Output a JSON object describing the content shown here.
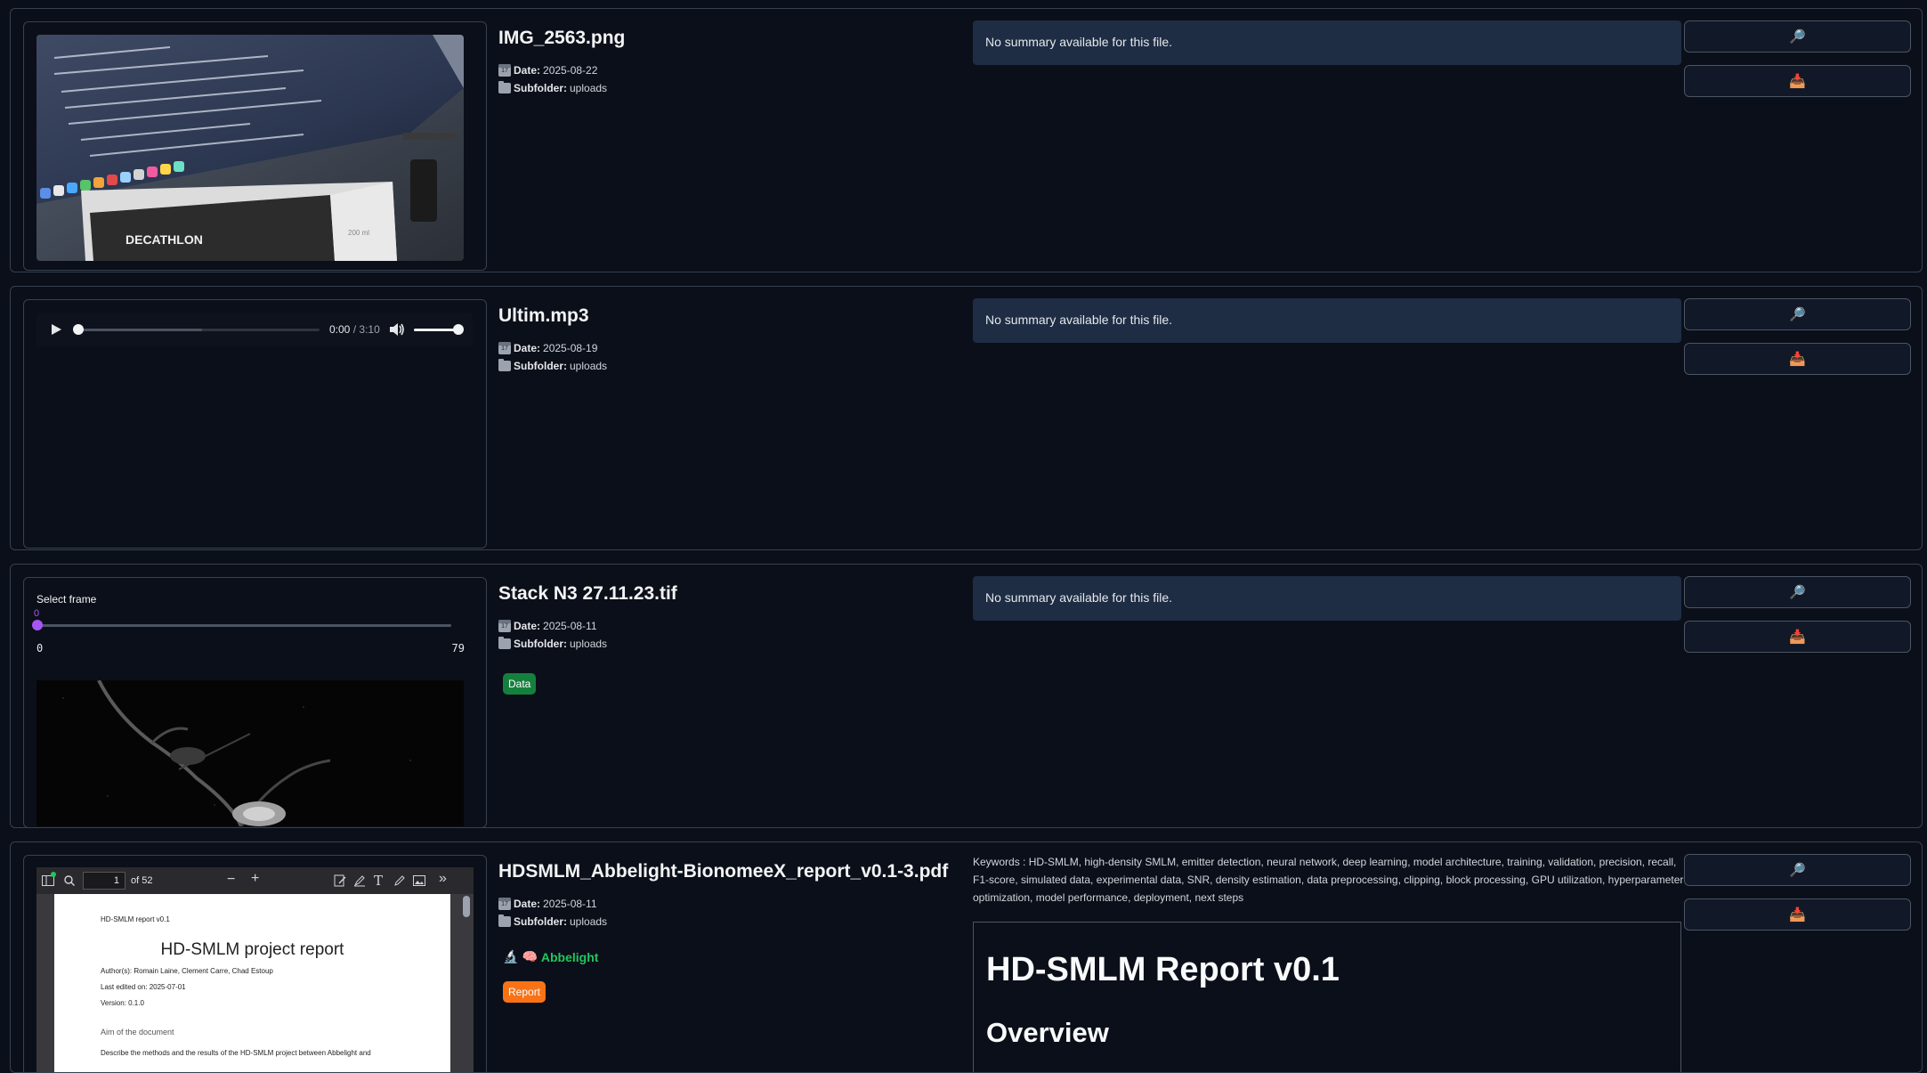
{
  "cards": [
    {
      "title": "IMG_2563.png",
      "date_label": "Date:",
      "date": "2025-08-22",
      "subfolder_label": "Subfolder:",
      "subfolder": "uploads",
      "summary": "No summary available for this file.",
      "photo_text": "DECATHLON",
      "photo_lid": "200 ml"
    },
    {
      "title": "Ultim.mp3",
      "date_label": "Date:",
      "date": "2025-08-19",
      "subfolder_label": "Subfolder:",
      "subfolder": "uploads",
      "summary": "No summary available for this file.",
      "audio_current": "0:00",
      "audio_sep": "/",
      "audio_total": "3:10",
      "audio_progress": 0,
      "audio_volume": 1
    },
    {
      "title": "Stack N3 27.11.23.tif",
      "date_label": "Date:",
      "date": "2025-08-11",
      "subfolder_label": "Subfolder:",
      "subfolder": "uploads",
      "summary": "No summary available for this file.",
      "slider_label": "Select frame",
      "slider_value": "0",
      "slider_min": "0",
      "slider_max": "79",
      "badge": "Data",
      "badge_color": "#15803d"
    },
    {
      "title": "HDSMLM_Abbelight-BionomeeX_report_v0.1-3.pdf",
      "date_label": "Date:",
      "date": "2025-08-11",
      "subfolder_label": "Subfolder:",
      "subfolder": "uploads",
      "tag": "Abbelight",
      "tag_color": "#22c55e",
      "badge": "Report",
      "badge_color": "#f97316",
      "keywords": "Keywords : HD-SMLM, high-density SMLM, emitter detection, neural network, deep learning, model architecture, training, validation, precision, recall, F1-score, simulated data, experimental data, SNR, density estimation, data preprocessing, clipping, block processing, GPU utilization, hyperparameter optimization, model performance, deployment, next steps",
      "markdown_h1": "HD-SMLM Report v0.1",
      "markdown_h2": "Overview",
      "pdf": {
        "page": "1",
        "of": "of 52",
        "doc_header": "HD-SMLM report v0.1",
        "doc_title": "HD-SMLM project report",
        "authors": "Author(s): Romain Laine, Clement Carre, Chad Estoup",
        "edited": "Last edited on: 2025-07-01",
        "version": "Version: 0.1.0",
        "aim": "Aim of the document",
        "describe": "Describe the methods and the results of the HD-SMLM project between Abbelight and"
      }
    }
  ],
  "buttons": {
    "view_icon": "magnifier-icon",
    "download_icon": "inbox-tray-icon"
  }
}
